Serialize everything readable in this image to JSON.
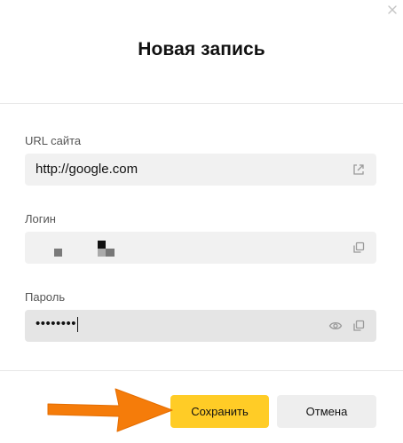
{
  "dialog": {
    "title": "Новая запись",
    "close_icon": "close-icon"
  },
  "fields": {
    "url": {
      "label": "URL сайта",
      "value": "http://google.com",
      "icon": "open-external-icon"
    },
    "login": {
      "label": "Логин",
      "value": "",
      "icon": "copy-icon"
    },
    "password": {
      "label": "Пароль",
      "value": "••••••••",
      "icons": [
        "eye-icon",
        "copy-icon"
      ]
    }
  },
  "actions": {
    "save_label": "Сохранить",
    "cancel_label": "Отмена"
  },
  "colors": {
    "save_button": "#ffcc26",
    "cancel_button": "#eeeeee",
    "field_bg": "#f1f1f1",
    "arrow": "#f57c0a"
  }
}
